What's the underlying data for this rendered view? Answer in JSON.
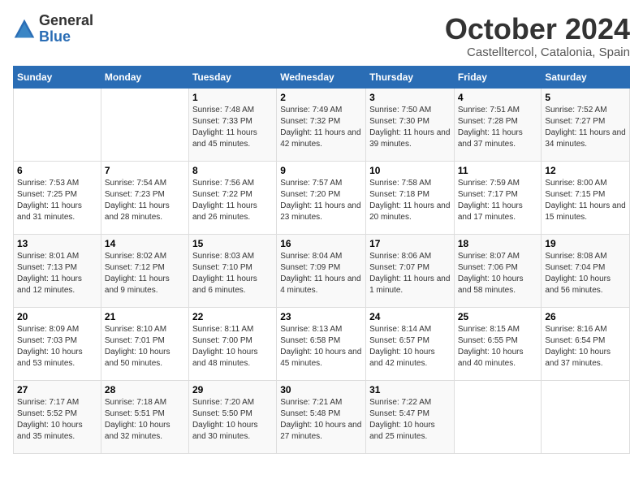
{
  "header": {
    "logo_general": "General",
    "logo_blue": "Blue",
    "month_title": "October 2024",
    "subtitle": "Castelltercol, Catalonia, Spain"
  },
  "days_of_week": [
    "Sunday",
    "Monday",
    "Tuesday",
    "Wednesday",
    "Thursday",
    "Friday",
    "Saturday"
  ],
  "weeks": [
    [
      {
        "day": "",
        "info": ""
      },
      {
        "day": "",
        "info": ""
      },
      {
        "day": "1",
        "info": "Sunrise: 7:48 AM\nSunset: 7:33 PM\nDaylight: 11 hours and 45 minutes."
      },
      {
        "day": "2",
        "info": "Sunrise: 7:49 AM\nSunset: 7:32 PM\nDaylight: 11 hours and 42 minutes."
      },
      {
        "day": "3",
        "info": "Sunrise: 7:50 AM\nSunset: 7:30 PM\nDaylight: 11 hours and 39 minutes."
      },
      {
        "day": "4",
        "info": "Sunrise: 7:51 AM\nSunset: 7:28 PM\nDaylight: 11 hours and 37 minutes."
      },
      {
        "day": "5",
        "info": "Sunrise: 7:52 AM\nSunset: 7:27 PM\nDaylight: 11 hours and 34 minutes."
      }
    ],
    [
      {
        "day": "6",
        "info": "Sunrise: 7:53 AM\nSunset: 7:25 PM\nDaylight: 11 hours and 31 minutes."
      },
      {
        "day": "7",
        "info": "Sunrise: 7:54 AM\nSunset: 7:23 PM\nDaylight: 11 hours and 28 minutes."
      },
      {
        "day": "8",
        "info": "Sunrise: 7:56 AM\nSunset: 7:22 PM\nDaylight: 11 hours and 26 minutes."
      },
      {
        "day": "9",
        "info": "Sunrise: 7:57 AM\nSunset: 7:20 PM\nDaylight: 11 hours and 23 minutes."
      },
      {
        "day": "10",
        "info": "Sunrise: 7:58 AM\nSunset: 7:18 PM\nDaylight: 11 hours and 20 minutes."
      },
      {
        "day": "11",
        "info": "Sunrise: 7:59 AM\nSunset: 7:17 PM\nDaylight: 11 hours and 17 minutes."
      },
      {
        "day": "12",
        "info": "Sunrise: 8:00 AM\nSunset: 7:15 PM\nDaylight: 11 hours and 15 minutes."
      }
    ],
    [
      {
        "day": "13",
        "info": "Sunrise: 8:01 AM\nSunset: 7:13 PM\nDaylight: 11 hours and 12 minutes."
      },
      {
        "day": "14",
        "info": "Sunrise: 8:02 AM\nSunset: 7:12 PM\nDaylight: 11 hours and 9 minutes."
      },
      {
        "day": "15",
        "info": "Sunrise: 8:03 AM\nSunset: 7:10 PM\nDaylight: 11 hours and 6 minutes."
      },
      {
        "day": "16",
        "info": "Sunrise: 8:04 AM\nSunset: 7:09 PM\nDaylight: 11 hours and 4 minutes."
      },
      {
        "day": "17",
        "info": "Sunrise: 8:06 AM\nSunset: 7:07 PM\nDaylight: 11 hours and 1 minute."
      },
      {
        "day": "18",
        "info": "Sunrise: 8:07 AM\nSunset: 7:06 PM\nDaylight: 10 hours and 58 minutes."
      },
      {
        "day": "19",
        "info": "Sunrise: 8:08 AM\nSunset: 7:04 PM\nDaylight: 10 hours and 56 minutes."
      }
    ],
    [
      {
        "day": "20",
        "info": "Sunrise: 8:09 AM\nSunset: 7:03 PM\nDaylight: 10 hours and 53 minutes."
      },
      {
        "day": "21",
        "info": "Sunrise: 8:10 AM\nSunset: 7:01 PM\nDaylight: 10 hours and 50 minutes."
      },
      {
        "day": "22",
        "info": "Sunrise: 8:11 AM\nSunset: 7:00 PM\nDaylight: 10 hours and 48 minutes."
      },
      {
        "day": "23",
        "info": "Sunrise: 8:13 AM\nSunset: 6:58 PM\nDaylight: 10 hours and 45 minutes."
      },
      {
        "day": "24",
        "info": "Sunrise: 8:14 AM\nSunset: 6:57 PM\nDaylight: 10 hours and 42 minutes."
      },
      {
        "day": "25",
        "info": "Sunrise: 8:15 AM\nSunset: 6:55 PM\nDaylight: 10 hours and 40 minutes."
      },
      {
        "day": "26",
        "info": "Sunrise: 8:16 AM\nSunset: 6:54 PM\nDaylight: 10 hours and 37 minutes."
      }
    ],
    [
      {
        "day": "27",
        "info": "Sunrise: 7:17 AM\nSunset: 5:52 PM\nDaylight: 10 hours and 35 minutes."
      },
      {
        "day": "28",
        "info": "Sunrise: 7:18 AM\nSunset: 5:51 PM\nDaylight: 10 hours and 32 minutes."
      },
      {
        "day": "29",
        "info": "Sunrise: 7:20 AM\nSunset: 5:50 PM\nDaylight: 10 hours and 30 minutes."
      },
      {
        "day": "30",
        "info": "Sunrise: 7:21 AM\nSunset: 5:48 PM\nDaylight: 10 hours and 27 minutes."
      },
      {
        "day": "31",
        "info": "Sunrise: 7:22 AM\nSunset: 5:47 PM\nDaylight: 10 hours and 25 minutes."
      },
      {
        "day": "",
        "info": ""
      },
      {
        "day": "",
        "info": ""
      }
    ]
  ]
}
